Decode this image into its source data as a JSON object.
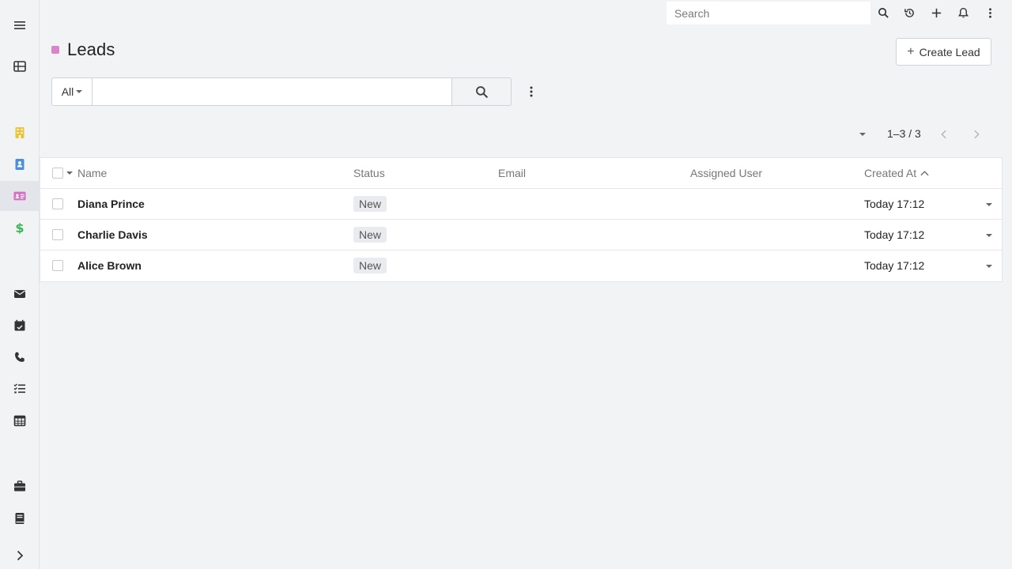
{
  "topbar": {
    "search_placeholder": "Search"
  },
  "header": {
    "title": "Leads",
    "create_label": "Create Lead",
    "accent_color": "#d670c4"
  },
  "filter": {
    "selected": "All",
    "search_value": ""
  },
  "pagination": {
    "range": "1–3 / 3"
  },
  "table": {
    "columns": {
      "name": "Name",
      "status": "Status",
      "email": "Email",
      "assigned_user": "Assigned User",
      "created_at": "Created At"
    },
    "sort": {
      "column": "created_at",
      "direction": "asc"
    },
    "rows": [
      {
        "name": "Diana Prince",
        "status": "New",
        "email": "",
        "assigned_user": "",
        "created_at": "Today 17:12"
      },
      {
        "name": "Charlie Davis",
        "status": "New",
        "email": "",
        "assigned_user": "",
        "created_at": "Today 17:12"
      },
      {
        "name": "Alice Brown",
        "status": "New",
        "email": "",
        "assigned_user": "",
        "created_at": "Today 17:12"
      }
    ]
  },
  "sidebar": {
    "items": [
      {
        "icon": "menu-icon"
      },
      {
        "icon": "grid-icon"
      },
      {
        "icon": "building-icon",
        "color": "#e8c53d"
      },
      {
        "icon": "contact-book-icon",
        "color": "#4a8fd8"
      },
      {
        "icon": "id-card-icon",
        "color": "#d670c4",
        "active": true
      },
      {
        "icon": "dollar-icon",
        "color": "#3cb55a"
      },
      {
        "icon": "envelope-icon"
      },
      {
        "icon": "calendar-check-icon"
      },
      {
        "icon": "phone-icon"
      },
      {
        "icon": "tasks-icon"
      },
      {
        "icon": "calendar-icon"
      },
      {
        "icon": "briefcase-icon"
      },
      {
        "icon": "book-icon"
      },
      {
        "icon": "chevron-right-icon"
      }
    ]
  }
}
